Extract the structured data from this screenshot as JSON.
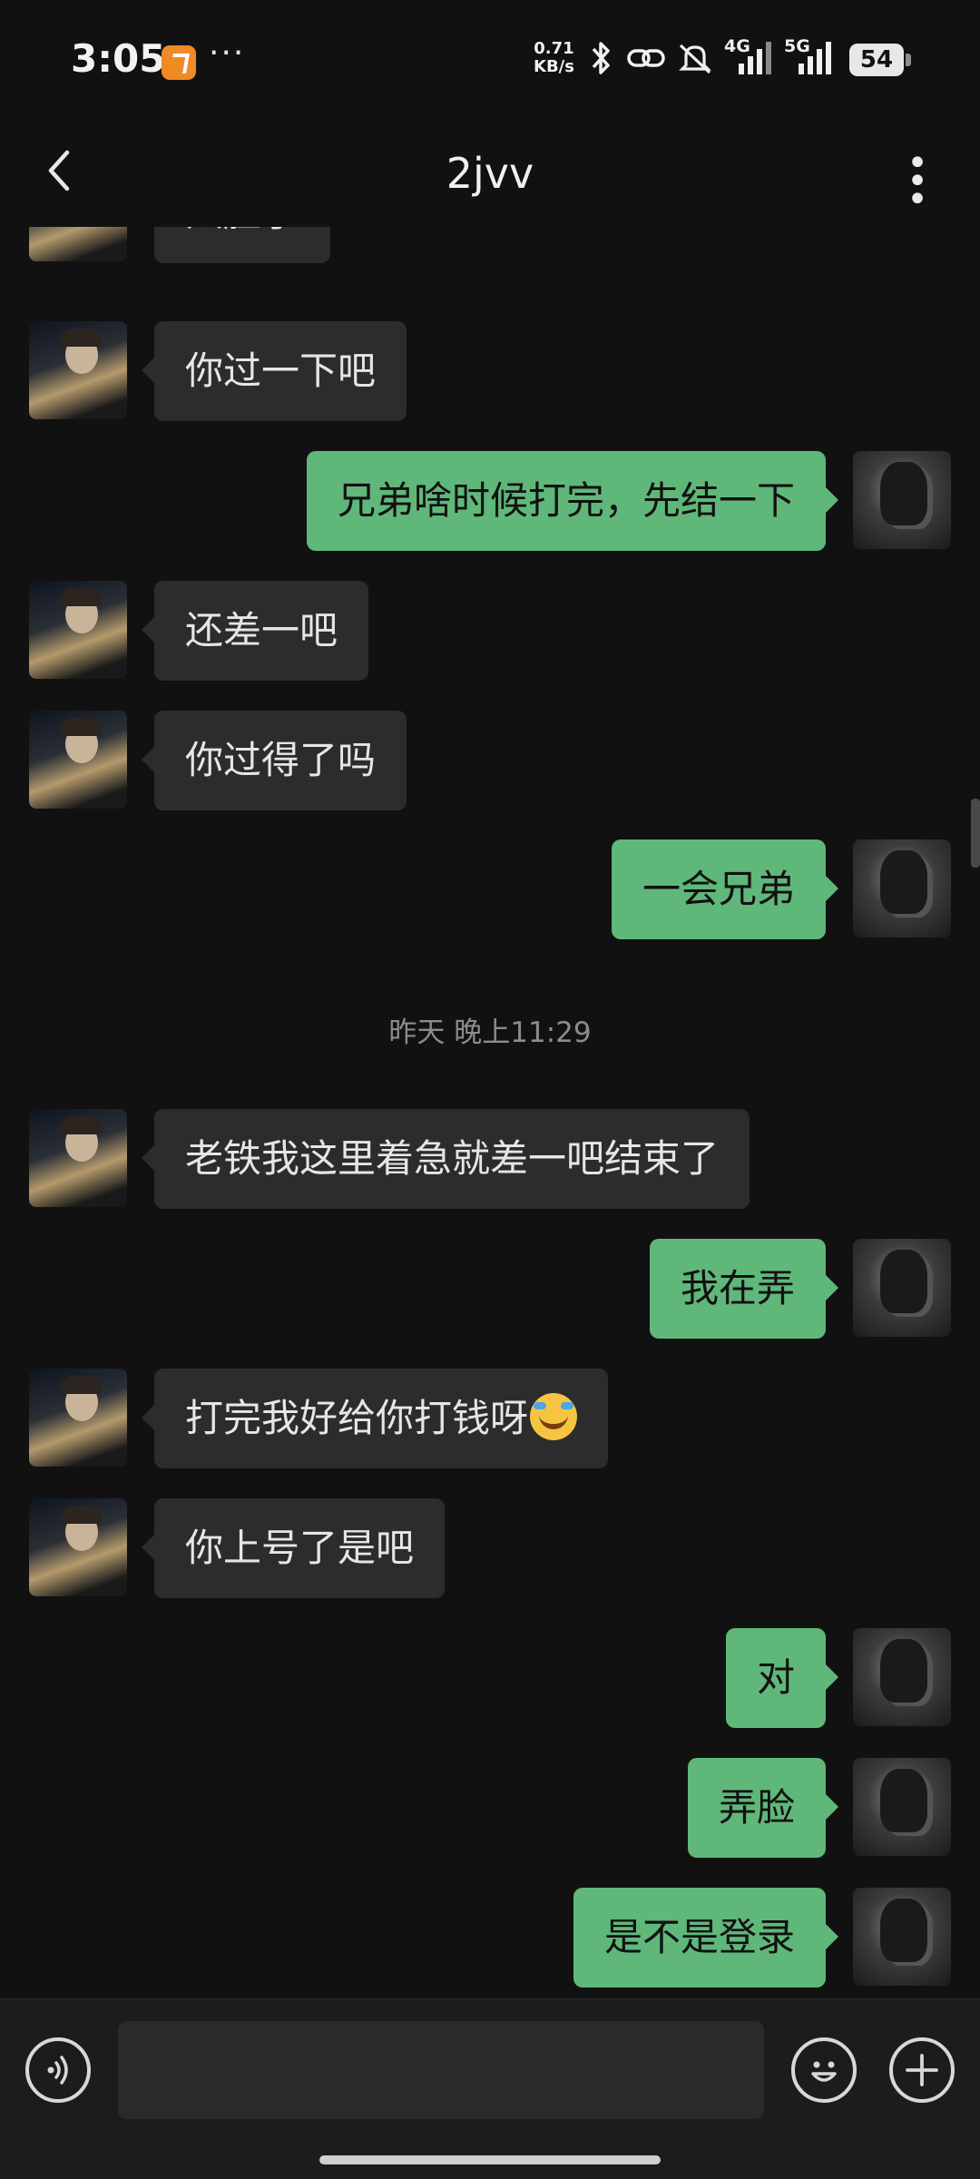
{
  "status_bar": {
    "time": "3:05",
    "net_speed_value": "0.71",
    "net_speed_unit": "KB/s",
    "network_4g": "4G",
    "network_5g": "5G",
    "battery": "54",
    "icons": [
      "app-badge-icon",
      "bluetooth-icon",
      "hotspot-link-icon",
      "mute-bell-icon",
      "signal-4g-icon",
      "signal-5g-icon",
      "battery-icon"
    ]
  },
  "header": {
    "title": "2jvv"
  },
  "chat": {
    "partial_top_message": "人脸了",
    "timestamp": "昨天 晚上11:29",
    "messages": [
      {
        "from": "peer",
        "text": "你过一下吧"
      },
      {
        "from": "me",
        "text": "兄弟啥时候打完，先结一下"
      },
      {
        "from": "peer",
        "text": "还差一吧"
      },
      {
        "from": "peer",
        "text": "你过得了吗"
      },
      {
        "from": "me",
        "text": "一会兄弟"
      },
      {
        "from": "peer",
        "text": "老铁我这里着急就差一吧结束了"
      },
      {
        "from": "me",
        "text": "我在弄"
      },
      {
        "from": "peer",
        "text": "打完我好给你打钱呀",
        "emoji": "crying-laughing-emoji"
      },
      {
        "from": "peer",
        "text": "你上号了是吧"
      },
      {
        "from": "me",
        "text": "对"
      },
      {
        "from": "me",
        "text": "弄脸"
      },
      {
        "from": "me",
        "text": "是不是登录"
      }
    ]
  },
  "input_bar": {
    "value": "",
    "placeholder": ""
  },
  "colors": {
    "background": "#111111",
    "peer_bubble": "#2c2c2c",
    "my_bubble": "#5fb87a",
    "timestamp_text": "#8c8c8c"
  }
}
